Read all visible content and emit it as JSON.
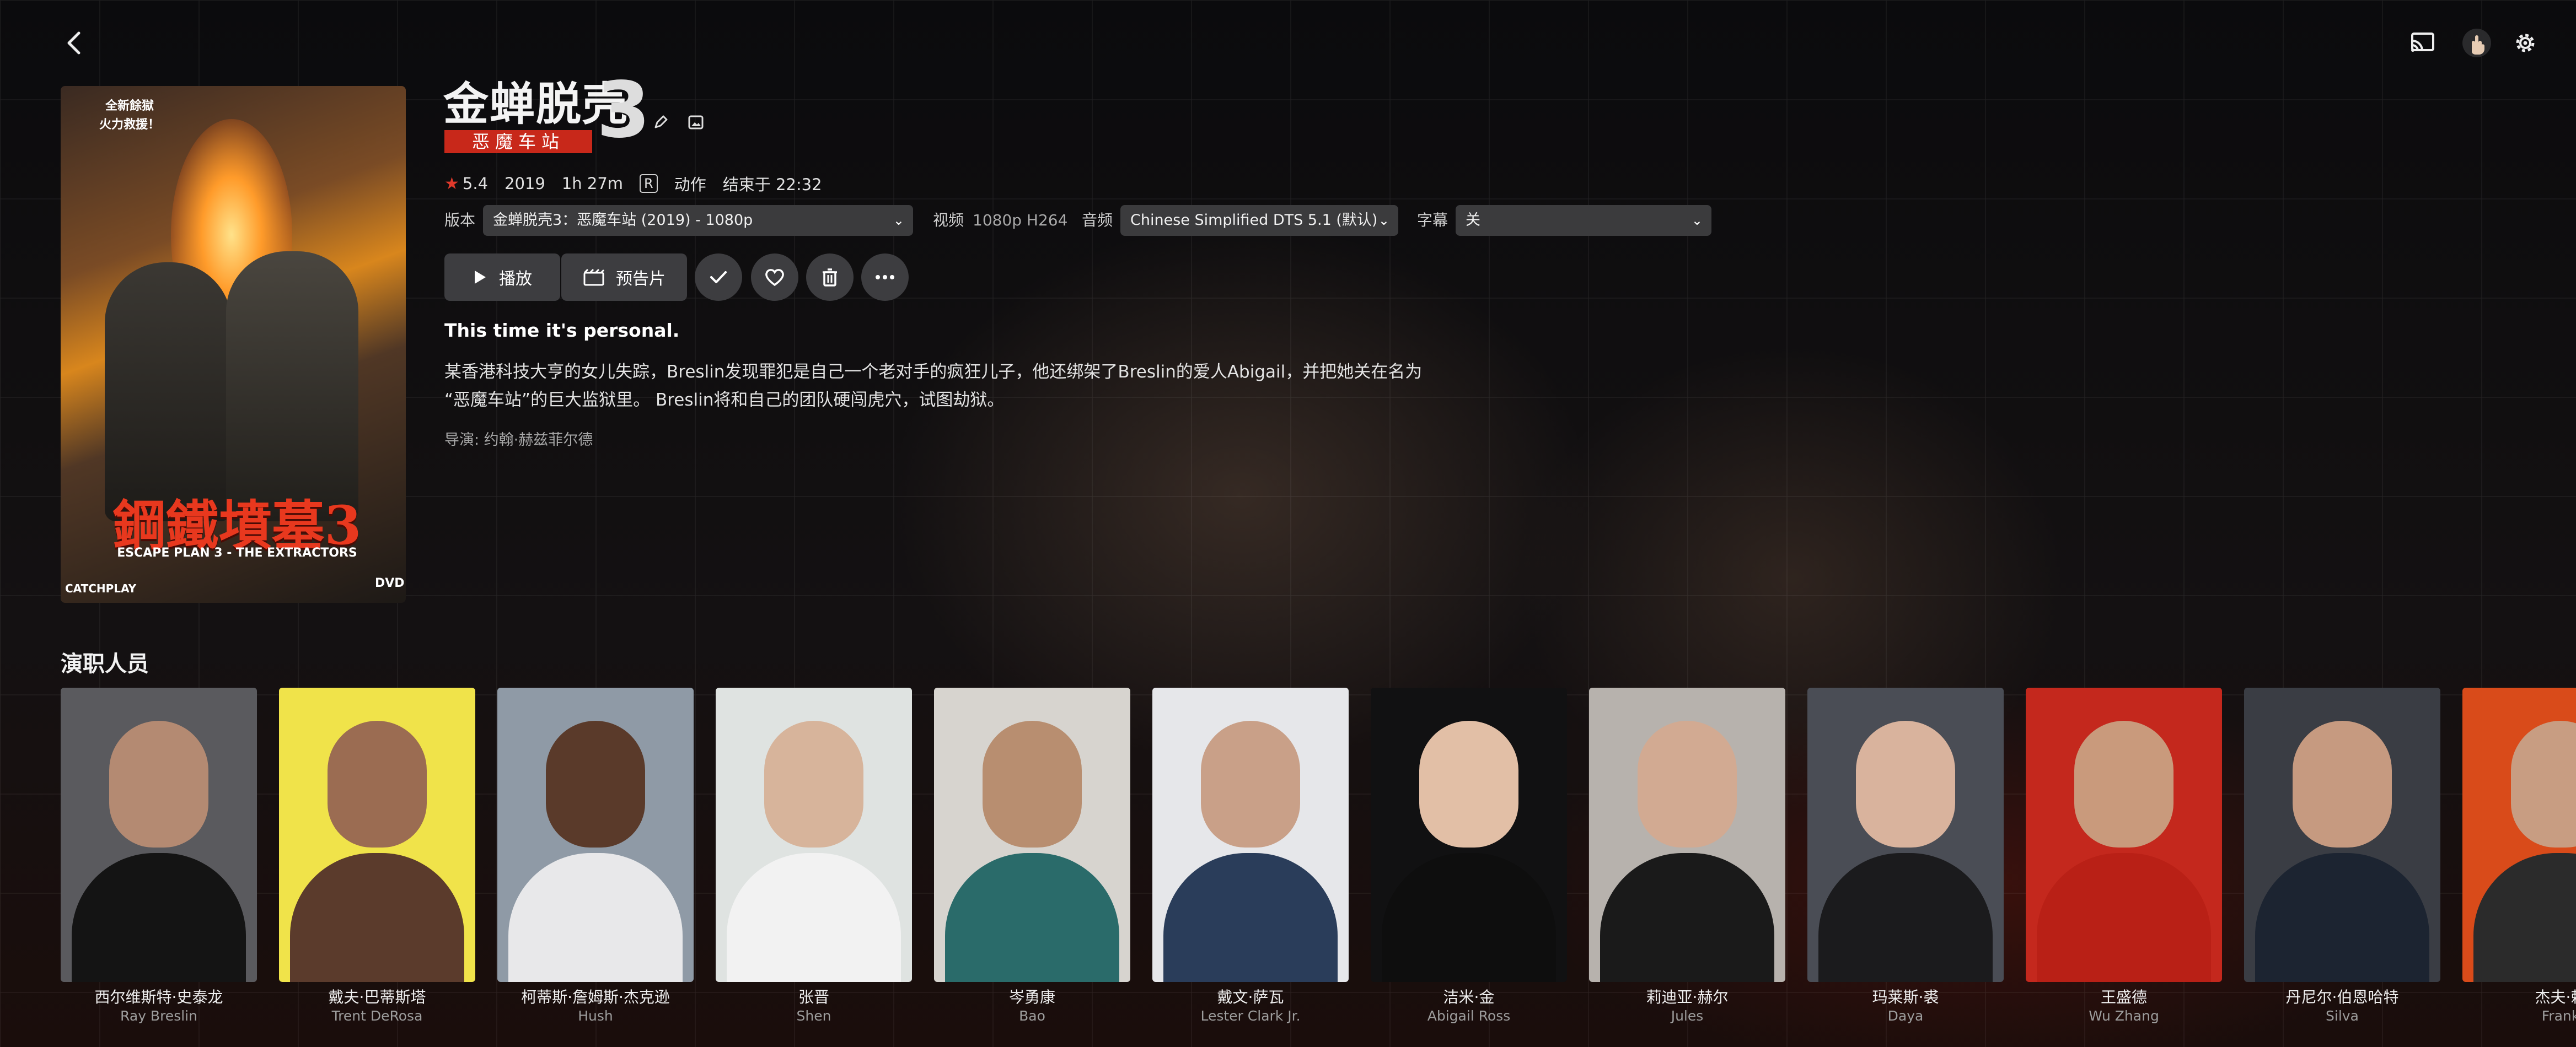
{
  "header": {
    "back_icon": "chevron-left-icon",
    "cast_icon": "cast-icon",
    "user_icon": "hand-avatar-icon",
    "settings_icon": "gear-icon"
  },
  "poster": {
    "tag_line1": "全新餘獄",
    "tag_line2": "火力救援！",
    "title": "鋼鐵墳墓3",
    "subtitle": "ESCAPE PLAN 3 - THE EXTRACTORS",
    "brand": "CATCHPLAY",
    "dvd": "DVD"
  },
  "movie": {
    "title_zh": "金蝉脱壳",
    "title_num": "3",
    "title_sub": "恶魔车站",
    "rating": "5.4",
    "year": "2019",
    "runtime": "1h 27m",
    "certification": "R",
    "genre": "动作",
    "ends_at": "结束于 22:32",
    "tagline": "This time it's personal.",
    "overview_line1": "某香港科技大亨的女儿失踪，Breslin发现罪犯是自己一个老对手的疯狂儿子，他还绑架了Breslin的爱人Abigail，并把她关在名为",
    "overview_line2": "“恶魔车站”的巨大监狱里。 Breslin将和自己的团队硬闯虎穴，试图劫狱。",
    "director": "导演: 约翰·赫兹菲尔德"
  },
  "selectors": {
    "version_label": "版本",
    "version_value": "金蝉脱壳3：恶魔车站 (2019) - 1080p",
    "video_label": "视频",
    "video_value": "1080p H264",
    "audio_label": "音频",
    "audio_value": "Chinese Simplified DTS 5.1 (默认)",
    "subtitle_label": "字幕",
    "subtitle_value": "关"
  },
  "actions": {
    "play_label": "播放",
    "trailer_label": "预告片"
  },
  "cast_section": {
    "title": "演职人员"
  },
  "cast": [
    {
      "name": "西尔维斯特·史泰龙",
      "role": "Ray Breslin",
      "bg": "#5a5a5e",
      "skin": "#b48a72",
      "cloth": "#141414"
    },
    {
      "name": "戴夫·巴蒂斯塔",
      "role": "Trent DeRosa",
      "bg": "#f0e34a",
      "skin": "#9b6c52",
      "cloth": "#5b3b2c"
    },
    {
      "name": "柯蒂斯·詹姆斯·杰克逊",
      "role": "Hush",
      "bg": "#8f9aa6",
      "skin": "#5a3a2a",
      "cloth": "#e8e8ea"
    },
    {
      "name": "张晋",
      "role": "Shen",
      "bg": "#dfe3e1",
      "skin": "#d7b49b",
      "cloth": "#f2f2f2"
    },
    {
      "name": "岑勇康",
      "role": "Bao",
      "bg": "#d7d4cf",
      "skin": "#b88e70",
      "cloth": "#2a6b6a"
    },
    {
      "name": "戴文·萨瓦",
      "role": "Lester Clark Jr.",
      "bg": "#e6e7ea",
      "skin": "#c9a088",
      "cloth": "#2a3d5a"
    },
    {
      "name": "洁米·金",
      "role": "Abigail Ross",
      "bg": "#111112",
      "skin": "#e2bfa6",
      "cloth": "#0e0e0e"
    },
    {
      "name": "莉迪亚·赫尔",
      "role": "Jules",
      "bg": "#b7b2ad",
      "skin": "#d2aa92",
      "cloth": "#1a1a1a"
    },
    {
      "name": "玛莱斯·裘",
      "role": "Daya",
      "bg": "#4a4d55",
      "skin": "#d9b39d",
      "cloth": "#1b1b1d"
    },
    {
      "name": "王盛德",
      "role": "Wu Zhang",
      "bg": "#c4281d",
      "skin": "#c99a7c",
      "cloth": "#b92016"
    },
    {
      "name": "丹尼尔·伯恩哈特",
      "role": "Silva",
      "bg": "#3a3d44",
      "skin": "#c69a80",
      "cloth": "#1c2431"
    },
    {
      "name": "杰夫·赖",
      "role": "Frank",
      "bg": "#d94b1a",
      "skin": "#c89d82",
      "cloth": "#2b2b2b"
    }
  ]
}
